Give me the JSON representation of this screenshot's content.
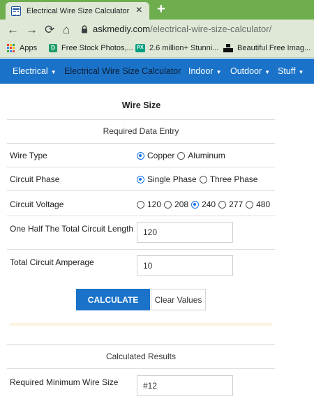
{
  "browser": {
    "tab_title": "Electrical Wire Size Calculator",
    "tab_close": "×",
    "new_tab": "+",
    "url_domain": "askmediy.com",
    "url_path": "/electrical-wire-size-calculator/",
    "bookmarks": [
      {
        "label": "Apps",
        "icon": "apps-grid-icon"
      },
      {
        "label": "Free Stock Photos,...",
        "icon": "d-icon"
      },
      {
        "label": "2.6 million+ Stunni...",
        "icon": "px-icon"
      },
      {
        "label": "Beautiful Free Imag...",
        "icon": "camera-icon"
      }
    ]
  },
  "site_nav": {
    "items": [
      {
        "label": "Electrical",
        "has_caret": true
      },
      {
        "label": "Electrical Wire Size Calculator",
        "active": true
      },
      {
        "label": "Indoor",
        "has_caret": true
      },
      {
        "label": "Outdoor",
        "has_caret": true
      },
      {
        "label": "Stuff",
        "has_caret": true
      }
    ],
    "bg_color": "#1a73c9"
  },
  "form": {
    "title": "Wire Size",
    "entry_heading": "Required Data Entry",
    "wire_type": {
      "label": "Wire Type",
      "options": [
        "Copper",
        "Aluminum"
      ],
      "selected": "Copper"
    },
    "circuit_phase": {
      "label": "Circuit Phase",
      "options": [
        "Single Phase",
        "Three Phase"
      ],
      "selected": "Single Phase"
    },
    "circuit_voltage": {
      "label": "Circuit Voltage",
      "options": [
        "120",
        "208",
        "240",
        "277",
        "480"
      ],
      "selected": "240"
    },
    "half_length": {
      "label": "One Half The Total Circuit Length",
      "value": "120"
    },
    "amperage": {
      "label": "Total Circuit Amperage",
      "value": "10"
    },
    "calculate_label": "CALCULATE",
    "clear_label": "Clear Values",
    "results_heading": "Calculated Results",
    "min_wire": {
      "label": "Required Minimum Wire Size",
      "value": "#12"
    }
  }
}
